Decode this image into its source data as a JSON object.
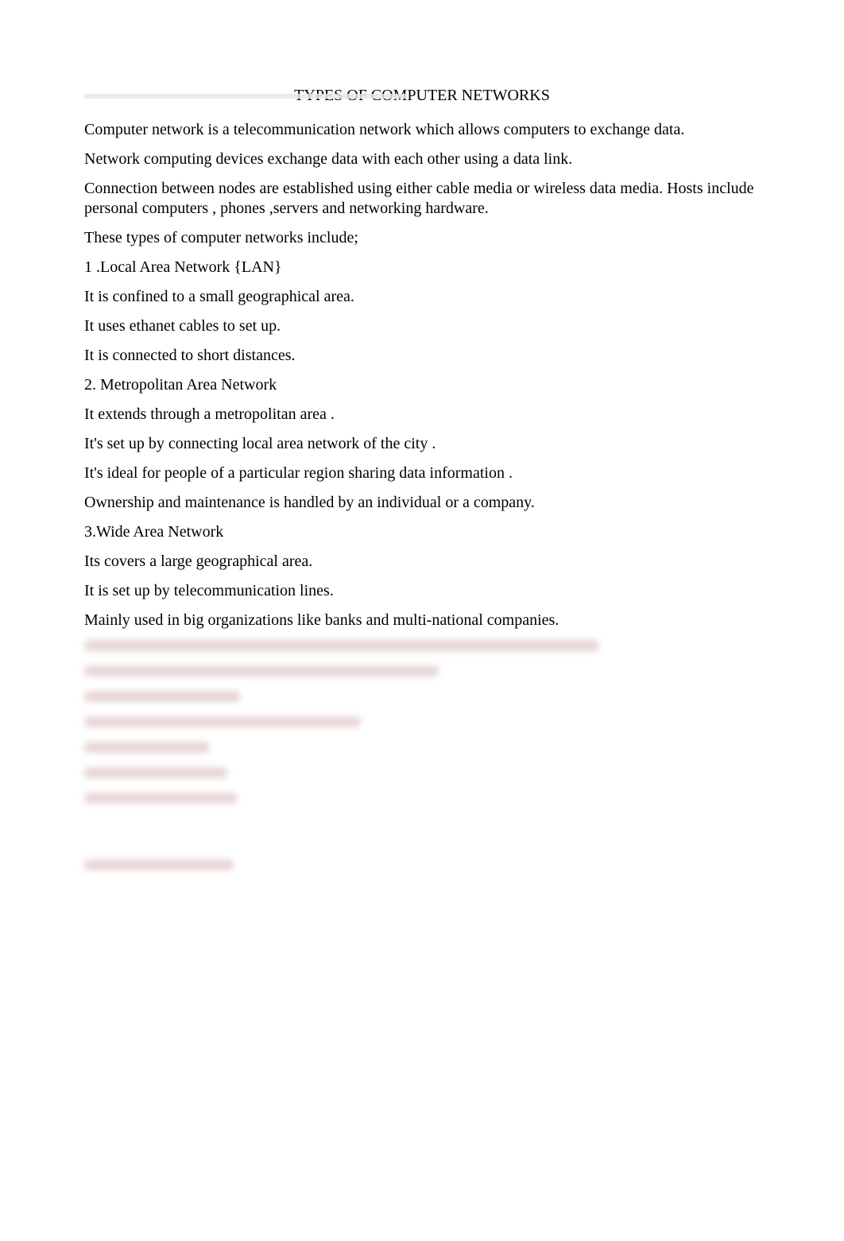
{
  "title": "TYPES OF COMPUTER NETWORKS",
  "paragraphs": {
    "p0": "Computer network is a telecommunication network which allows computers to exchange data.",
    "p1": "Network computing devices exchange data with each other using a data link.",
    "p2": "Connection between nodes are established using either cable media or wireless data media. Hosts include personal computers , phones ,servers and networking hardware.",
    "p3": "These types of computer networks include;",
    "p4": "1 .Local Area Network {LAN}",
    "p5": "It is confined to a small geographical area.",
    "p6": "It uses ethanet cables to set up.",
    "p7": "It is connected to short distances.",
    "p8": "2. Metropolitan Area Network",
    "p9": "It extends through a metropolitan area    .",
    "p10": "It's set up by connecting local area network of the city .",
    "p11": "It's ideal for people of a particular region sharing data information .",
    "p12": "Ownership and maintenance is handled by an individual or a company.",
    "p13": "3.Wide Area Network",
    "p14": "Its covers a large geographical area.",
    "p15": "It is set up by telecommunication lines.",
    "p16": "Mainly used in big organizations like banks and multi-national companies."
  },
  "blurred_line_widths": [
    648,
    446,
    196,
    348,
    158,
    180,
    192,
    188
  ]
}
